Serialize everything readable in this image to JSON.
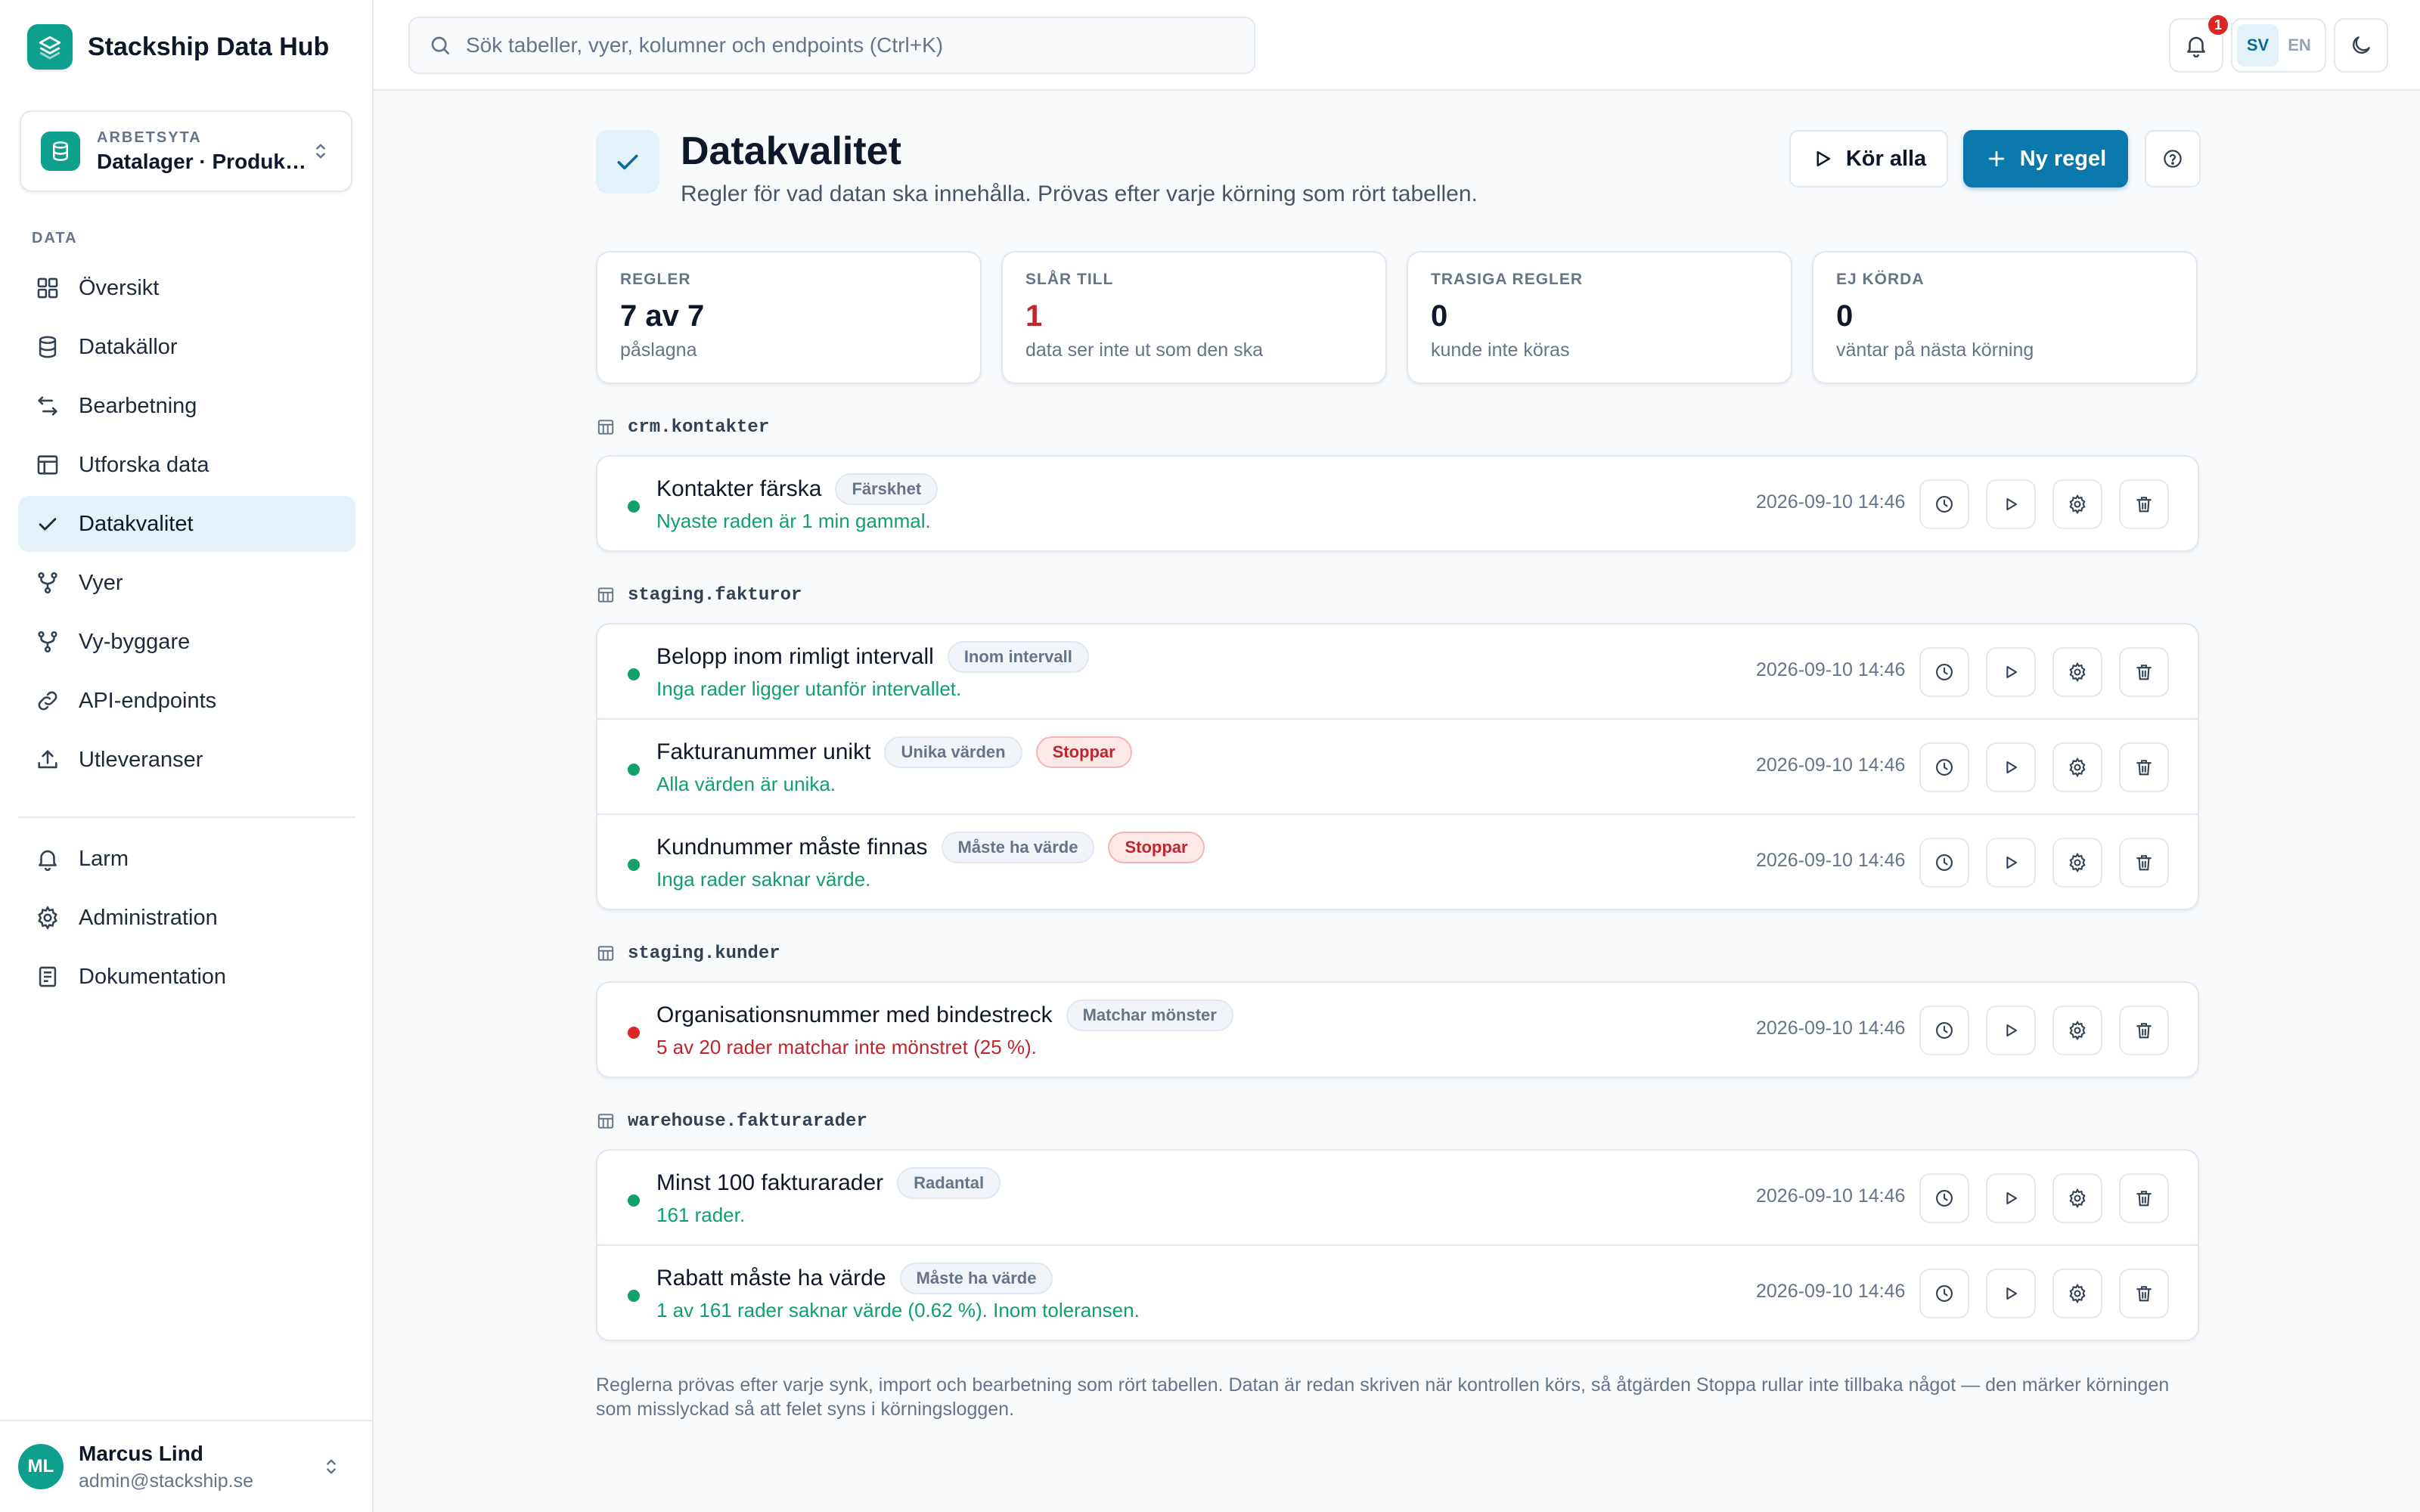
{
  "app": {
    "name": "Stackship Data Hub"
  },
  "workspace": {
    "label": "ARBETSYTA",
    "value": "Datalager · Produktion"
  },
  "sidebar": {
    "section_label": "DATA",
    "items": [
      {
        "label": "Översikt",
        "icon": "grid-icon"
      },
      {
        "label": "Datakällor",
        "icon": "database-icon"
      },
      {
        "label": "Bearbetning",
        "icon": "transform-arrows-icon"
      },
      {
        "label": "Utforska data",
        "icon": "table-icon"
      },
      {
        "label": "Datakvalitet",
        "icon": "check-icon",
        "active": true
      },
      {
        "label": "Vyer",
        "icon": "branch-icon"
      },
      {
        "label": "Vy-byggare",
        "icon": "branch-icon"
      },
      {
        "label": "API-endpoints",
        "icon": "link-icon"
      },
      {
        "label": "Utleveranser",
        "icon": "upload-icon"
      }
    ],
    "secondary_items": [
      {
        "label": "Larm",
        "icon": "bell-icon"
      },
      {
        "label": "Administration",
        "icon": "gear-icon"
      },
      {
        "label": "Dokumentation",
        "icon": "document-icon"
      }
    ]
  },
  "user": {
    "initials": "ML",
    "name": "Marcus Lind",
    "email": "admin@stackship.se"
  },
  "topbar": {
    "search_placeholder": "Sök tabeller, vyer, kolumner och endpoints (Ctrl+K)",
    "notification_count": "1",
    "languages": [
      "SV",
      "EN"
    ],
    "active_language": "SV"
  },
  "page": {
    "title": "Datakvalitet",
    "subtitle": "Regler för vad datan ska innehålla. Prövas efter varje körning som rört tabellen.",
    "run_all_label": "Kör alla",
    "new_rule_label": "Ny regel"
  },
  "stats": [
    {
      "label": "REGLER",
      "value": "7 av 7",
      "desc": "påslagna"
    },
    {
      "label": "SLÅR TILL",
      "value": "1",
      "desc": "data ser inte ut som den ska"
    },
    {
      "label": "TRASIGA REGLER",
      "value": "0",
      "desc": "kunde inte köras"
    },
    {
      "label": "EJ KÖRDA",
      "value": "0",
      "desc": "väntar på nästa körning"
    }
  ],
  "groups": [
    {
      "table": "crm.kontakter",
      "rules": [
        {
          "title": "Kontakter färska",
          "type": "Färskhet",
          "stop": "",
          "status": "ok",
          "message": "Nyaste raden är 1 min gammal.",
          "time": "2026-09-10 14:46"
        }
      ]
    },
    {
      "table": "staging.fakturor",
      "rules": [
        {
          "title": "Belopp inom rimligt intervall",
          "type": "Inom intervall",
          "stop": "",
          "status": "ok",
          "message": "Inga rader ligger utanför intervallet.",
          "time": "2026-09-10 14:46"
        },
        {
          "title": "Fakturanummer unikt",
          "type": "Unika värden",
          "stop": "Stoppar",
          "status": "ok",
          "message": "Alla värden är unika.",
          "time": "2026-09-10 14:46"
        },
        {
          "title": "Kundnummer måste finnas",
          "type": "Måste ha värde",
          "stop": "Stoppar",
          "status": "ok",
          "message": "Inga rader saknar värde.",
          "time": "2026-09-10 14:46"
        }
      ]
    },
    {
      "table": "staging.kunder",
      "rules": [
        {
          "title": "Organisationsnummer med bindestreck",
          "type": "Matchar mönster",
          "stop": "",
          "status": "fail",
          "message": "5 av 20 rader matchar inte mönstret (25 %).",
          "time": "2026-09-10 14:46"
        }
      ]
    },
    {
      "table": "warehouse.fakturarader",
      "rules": [
        {
          "title": "Minst 100 fakturarader",
          "type": "Radantal",
          "stop": "",
          "status": "ok",
          "message": "161 rader.",
          "time": "2026-09-10 14:46"
        },
        {
          "title": "Rabatt måste ha värde",
          "type": "Måste ha värde",
          "stop": "",
          "status": "ok",
          "message": "1 av 161 rader saknar värde (0.62 %). Inom toleransen.",
          "time": "2026-09-10 14:46"
        }
      ]
    }
  ],
  "footnote": "Reglerna prövas efter varje synk, import och bearbetning som rört tabellen. Datan är redan skriven när kontrollen körs, så åtgärden Stoppa rullar inte tillbaka något — den märker körningen som misslyckad så att felet syns i körningsloggen.",
  "colors": {
    "brand": "#0f9f8f",
    "primary": "#0b78ad",
    "ok": "#10a06a",
    "fail": "#dc2626"
  }
}
